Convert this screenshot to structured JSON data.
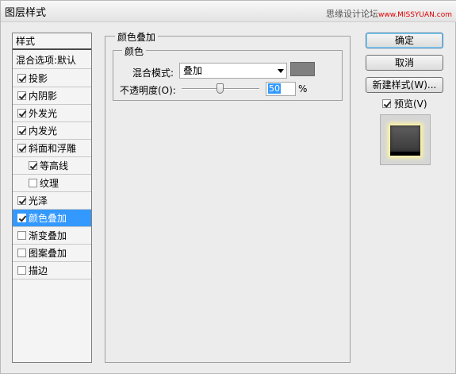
{
  "window": {
    "title": "图层样式",
    "watermark_main": "思缘设计论坛",
    "watermark_domain": "www.MISSYUAN.com"
  },
  "sidebar": {
    "header": "样式",
    "blend_options": "混合选项:默认",
    "items": [
      {
        "label": "投影",
        "checked": true,
        "indent": false
      },
      {
        "label": "内阴影",
        "checked": true,
        "indent": false
      },
      {
        "label": "外发光",
        "checked": true,
        "indent": false
      },
      {
        "label": "内发光",
        "checked": true,
        "indent": false
      },
      {
        "label": "斜面和浮雕",
        "checked": true,
        "indent": false
      },
      {
        "label": "等高线",
        "checked": true,
        "indent": true
      },
      {
        "label": "纹理",
        "checked": false,
        "indent": true
      },
      {
        "label": "光泽",
        "checked": true,
        "indent": false
      },
      {
        "label": "颜色叠加",
        "checked": true,
        "indent": false,
        "selected": true
      },
      {
        "label": "渐变叠加",
        "checked": false,
        "indent": false
      },
      {
        "label": "图案叠加",
        "checked": false,
        "indent": false
      },
      {
        "label": "描边",
        "checked": false,
        "indent": false
      }
    ]
  },
  "panel": {
    "section_title": "颜色叠加",
    "group_title": "颜色",
    "blend_mode_label": "混合模式:",
    "blend_mode_value": "叠加",
    "overlay_color": "#808080",
    "opacity_label": "不透明度(O):",
    "opacity_value": "50",
    "opacity_unit": "%"
  },
  "buttons": {
    "ok": "确定",
    "cancel": "取消",
    "new_style": "新建样式(W)...",
    "preview_label": "预览(V)",
    "preview_checked": true
  }
}
